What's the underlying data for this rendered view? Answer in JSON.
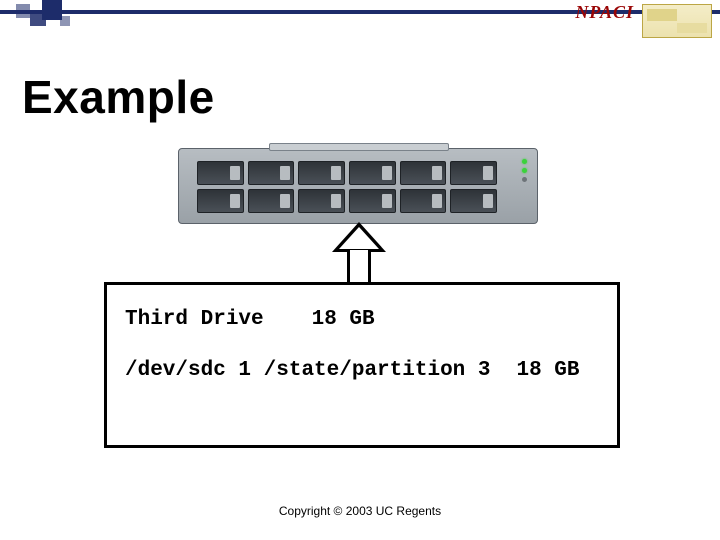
{
  "header": {
    "logo_text": "NPACI"
  },
  "title": "Example",
  "drive_row": {
    "label": "Third Drive",
    "size": "18 GB"
  },
  "partition_row": {
    "device": "/dev/sdc 1",
    "mount": "/state/partition 3",
    "size": "18 GB"
  },
  "footer": {
    "copyright": "Copyright © 2003 UC Regents"
  }
}
